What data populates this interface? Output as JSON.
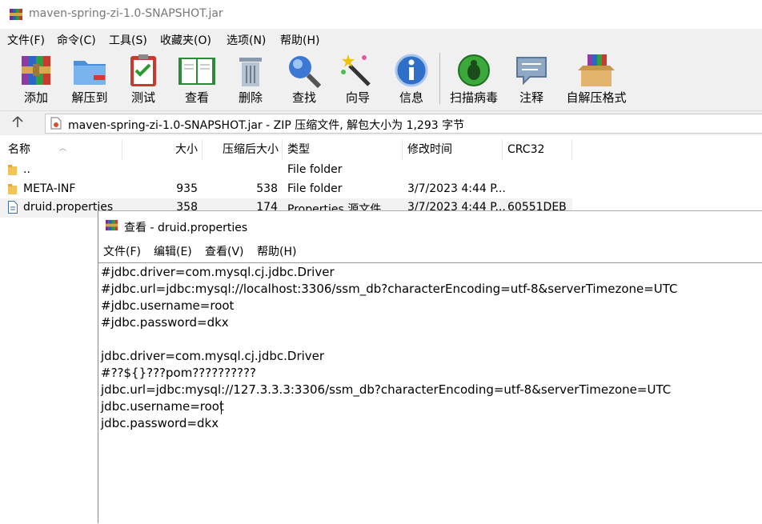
{
  "window": {
    "title": "maven-spring-zi-1.0-SNAPSHOT.jar"
  },
  "menu": [
    "文件(F)",
    "命令(C)",
    "工具(S)",
    "收藏夹(O)",
    "选项(N)",
    "帮助(H)"
  ],
  "toolbar": {
    "add": "添加",
    "extract": "解压到",
    "test": "测试",
    "view": "查看",
    "delete": "删除",
    "find": "查找",
    "wizard": "向导",
    "info": "信息",
    "scan": "扫描病毒",
    "comment": "注释",
    "sfx": "自解压格式"
  },
  "address": {
    "path": "maven-spring-zi-1.0-SNAPSHOT.jar - ZIP 压缩文件, 解包大小为 1,293 字节"
  },
  "columns": {
    "name": "名称",
    "size": "大小",
    "packed": "压缩后大小",
    "type": "类型",
    "modified": "修改时间",
    "crc": "CRC32"
  },
  "files": [
    {
      "name": "..",
      "size": "",
      "packed": "",
      "type": "File folder",
      "modified": "",
      "crc": ""
    },
    {
      "name": "META-INF",
      "size": "935",
      "packed": "538",
      "type": "File folder",
      "modified": "3/7/2023 4:44 P...",
      "crc": ""
    },
    {
      "name": "druid.properties",
      "size": "358",
      "packed": "174",
      "type": "Properties 源文件",
      "modified": "3/7/2023 4:44 P...",
      "crc": "60551DEB"
    }
  ],
  "viewer": {
    "title": "查看 - druid.properties",
    "menu": [
      "文件(F)",
      "编辑(E)",
      "查看(V)",
      "帮助(H)"
    ],
    "lines": [
      "#jdbc.driver=com.mysql.cj.jdbc.Driver",
      "#jdbc.url=jdbc:mysql://localhost:3306/ssm_db?characterEncoding=utf-8&serverTimezone=UTC",
      "#jdbc.username=root",
      "#jdbc.password=dkx",
      "",
      "jdbc.driver=com.mysql.cj.jdbc.Driver",
      "#??${}???pom??????????",
      "jdbc.url=jdbc:mysql://127.3.3.3:3306/ssm_db?characterEncoding=utf-8&serverTimezone=UTC",
      "jdbc.username=root",
      "jdbc.password=dkx"
    ]
  }
}
